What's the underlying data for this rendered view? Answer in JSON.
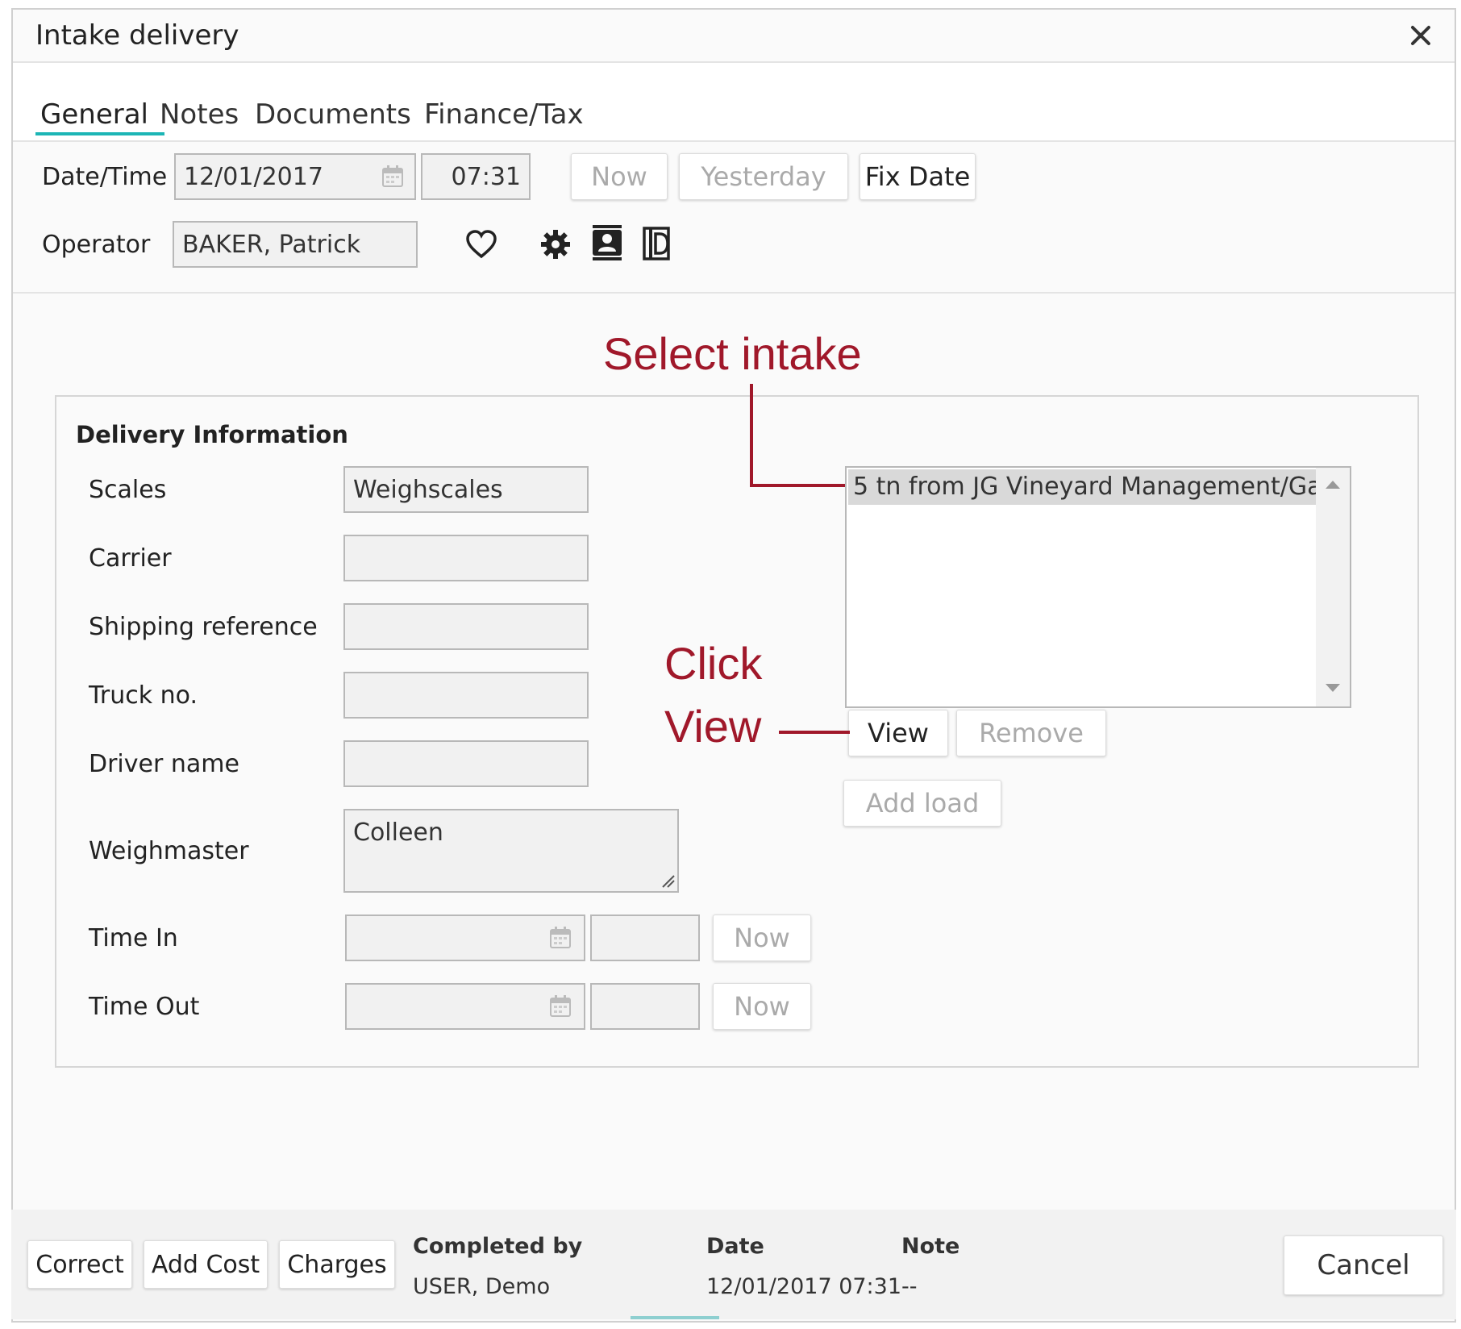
{
  "dialog": {
    "title": "Intake delivery",
    "close_icon": "close-icon"
  },
  "tabs": [
    {
      "label": "General",
      "active": true
    },
    {
      "label": "Notes"
    },
    {
      "label": "Documents"
    },
    {
      "label": "Finance/Tax"
    }
  ],
  "header": {
    "datetime_label": "Date/Time",
    "date_value": "12/01/2017",
    "time_value": "07:31",
    "now_label": "Now",
    "yesterday_label": "Yesterday",
    "fix_date_label": "Fix Date",
    "operator_label": "Operator",
    "operator_value": "BAKER, Patrick",
    "icons": [
      "heart-icon",
      "gear-icon",
      "contact-card-icon",
      "document-id-icon"
    ]
  },
  "delivery": {
    "title": "Delivery Information",
    "scales_label": "Scales",
    "scales_value": "Weighscales",
    "carrier_label": "Carrier",
    "carrier_value": "",
    "shipping_label": "Shipping reference",
    "shipping_value": "",
    "truck_label": "Truck no.",
    "truck_value": "",
    "driver_label": "Driver name",
    "driver_value": "",
    "weighmaster_label": "Weighmaster",
    "weighmaster_value": "Colleen",
    "time_in_label": "Time In",
    "time_out_label": "Time Out",
    "now_label": "Now"
  },
  "intake_list": {
    "items": [
      "5 tn from JG Vineyard Management/Ga"
    ],
    "view_label": "View",
    "remove_label": "Remove",
    "add_load_label": "Add load"
  },
  "annotations": {
    "select_intake": "Select intake",
    "click": "Click",
    "view": "View",
    "color": "#a0182a"
  },
  "footer": {
    "correct_label": "Correct",
    "add_cost_label": "Add Cost",
    "charges_label": "Charges",
    "completed_by_head": "Completed by",
    "completed_by_value": "USER, Demo",
    "date_head": "Date",
    "date_value": "12/01/2017 07:31",
    "note_head": "Note",
    "note_value": "--",
    "cancel_label": "Cancel"
  },
  "colors": {
    "accent": "#1cb5b5",
    "annotation": "#a0182a"
  }
}
